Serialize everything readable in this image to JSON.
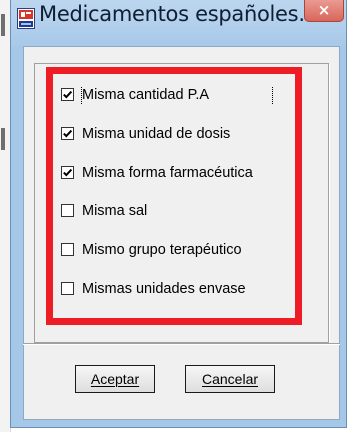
{
  "window": {
    "title": "Medicamentos españoles...",
    "close_glyph": "×",
    "app_icon": "app-icon"
  },
  "options": [
    {
      "label": "Misma cantidad P.A",
      "checked": true
    },
    {
      "label": "Misma unidad de dosis",
      "checked": true
    },
    {
      "label": "Misma forma farmacéutica",
      "checked": true
    },
    {
      "label": "Misma sal",
      "checked": false
    },
    {
      "label": "Mismo grupo terapéutico",
      "checked": false
    },
    {
      "label": "Mismas unidades envase",
      "checked": false
    }
  ],
  "buttons": {
    "accept_label": "Aceptar",
    "cancel_label": "Cancelar"
  },
  "colors": {
    "highlight_border": "#ee1c24",
    "titlebar": "#a9c9ea",
    "close_button": "#d8665c"
  }
}
